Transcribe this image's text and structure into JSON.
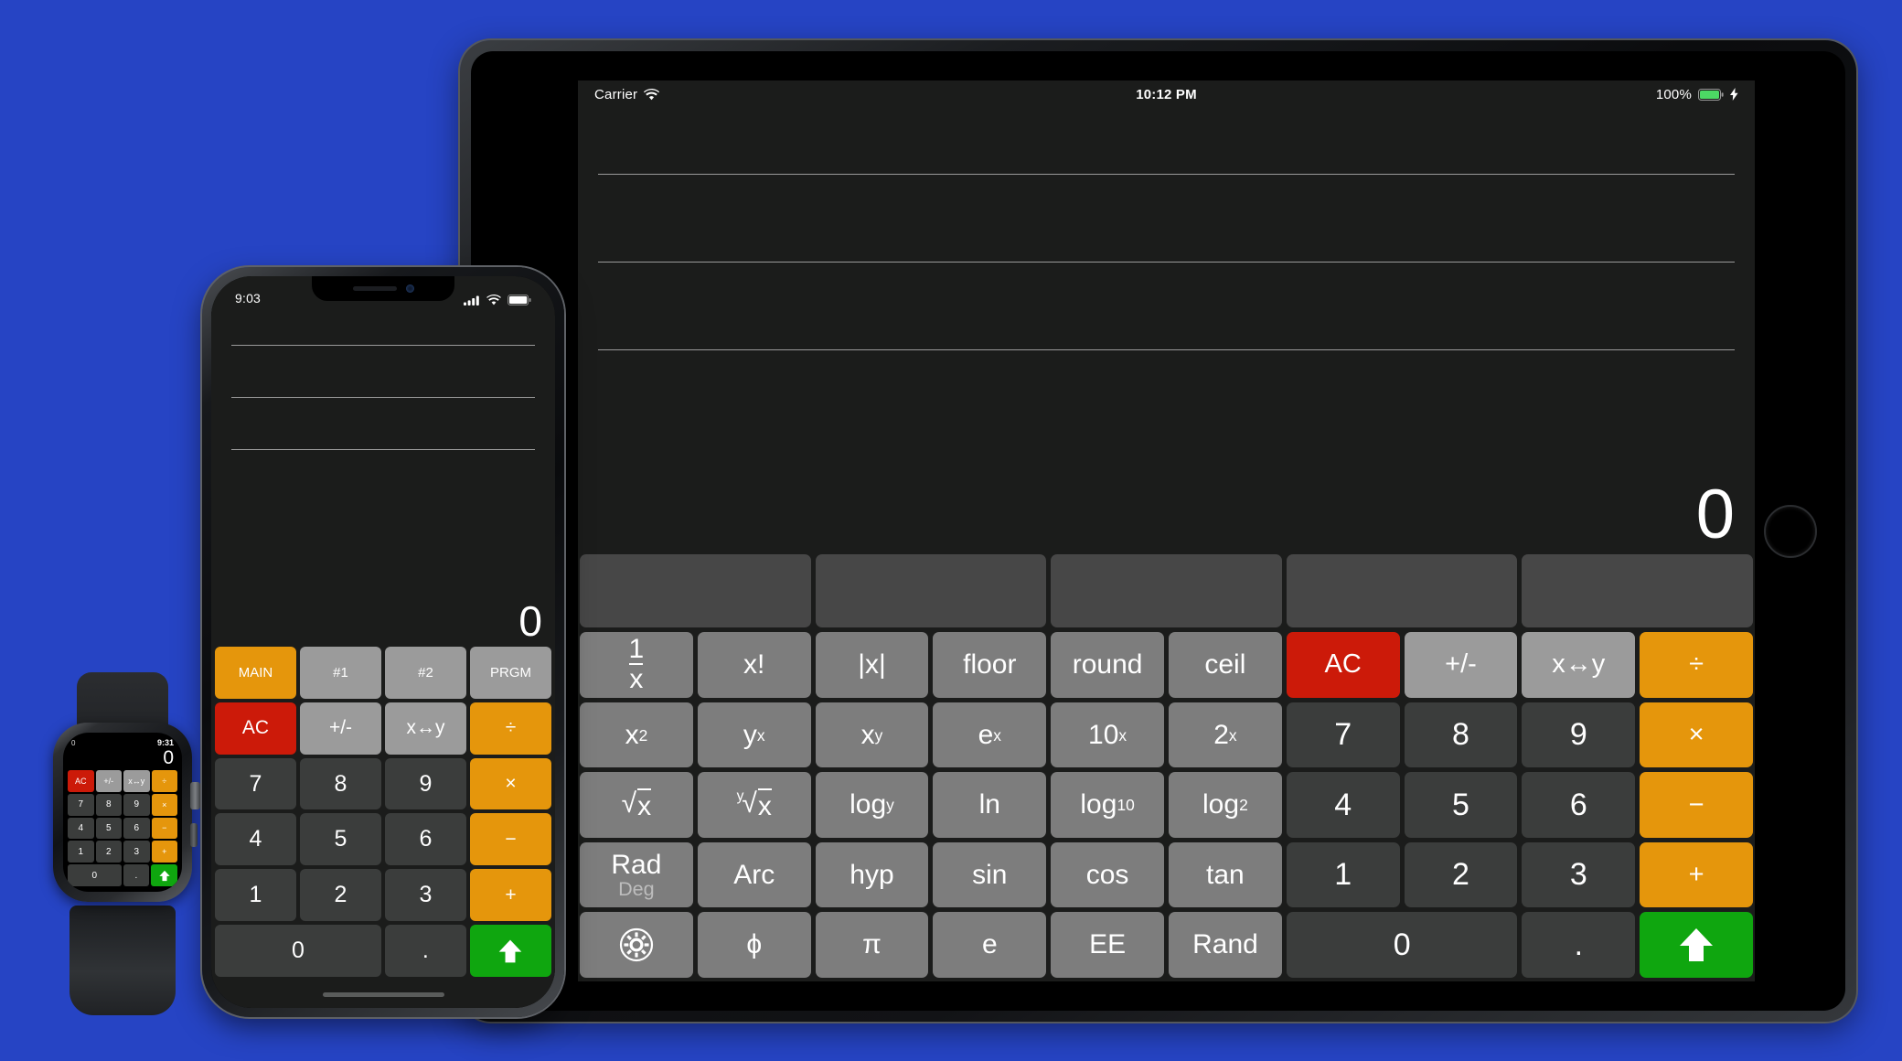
{
  "background_color": "#2644c4",
  "colors": {
    "ac_red": "#cc1a09",
    "operator_orange": "#e5960c",
    "enter_green": "#0fa60f",
    "function_gray": "#7d7d7d",
    "light_gray": "#9b9b9b",
    "number_gray": "#3b3d3c",
    "tab_gray": "#474747",
    "screen_black": "#1b1c1b"
  },
  "ipad": {
    "status_bar": {
      "carrier": "Carrier",
      "wifi_icon": "wifi-icon",
      "time": "10:12 PM",
      "battery_percent": "100%",
      "battery_icon": "battery-full-icon",
      "charging_icon": "lightning-bolt-icon"
    },
    "display": {
      "value": "0",
      "rule_count": 3
    },
    "tabs": [
      "",
      "",
      "",
      "",
      ""
    ],
    "keys": {
      "row1": [
        {
          "label": "1/x",
          "kind": "fraction",
          "num": "1",
          "den": "x",
          "style": "fn"
        },
        {
          "label": "x!",
          "style": "fn"
        },
        {
          "label": "|x|",
          "style": "fn"
        },
        {
          "label": "floor",
          "style": "fn"
        },
        {
          "label": "round",
          "style": "fn"
        },
        {
          "label": "ceil",
          "style": "fn"
        },
        {
          "label": "AC",
          "style": "ac"
        },
        {
          "label": "+/-",
          "style": "light"
        },
        {
          "label": "x↔y",
          "style": "light"
        },
        {
          "label": "÷",
          "style": "op"
        }
      ],
      "row2": [
        {
          "label": "x2",
          "base": "x",
          "sup": "2",
          "style": "fn"
        },
        {
          "label": "yx",
          "base": "y",
          "sup": "x",
          "style": "fn"
        },
        {
          "label": "xy",
          "base": "x",
          "sup": "y",
          "style": "fn"
        },
        {
          "label": "ex",
          "base": "e",
          "sup": "x",
          "style": "fn"
        },
        {
          "label": "10x",
          "base": "10",
          "sup": "x",
          "style": "fn"
        },
        {
          "label": "2x",
          "base": "2",
          "sup": "x",
          "style": "fn"
        },
        {
          "label": "7",
          "style": "num"
        },
        {
          "label": "8",
          "style": "num"
        },
        {
          "label": "9",
          "style": "num"
        },
        {
          "label": "×",
          "style": "op"
        }
      ],
      "row3": [
        {
          "label": "√x",
          "kind": "radical",
          "index": "",
          "style": "fn"
        },
        {
          "label": "y√x",
          "kind": "radical",
          "index": "y",
          "style": "fn"
        },
        {
          "label": "logy",
          "base": "log",
          "sub": "y",
          "style": "fn"
        },
        {
          "label": "ln",
          "style": "fn"
        },
        {
          "label": "log10",
          "base": "log",
          "sub": "10",
          "style": "fn"
        },
        {
          "label": "log2",
          "base": "log",
          "sub": "2",
          "style": "fn"
        },
        {
          "label": "4",
          "style": "num"
        },
        {
          "label": "5",
          "style": "num"
        },
        {
          "label": "6",
          "style": "num"
        },
        {
          "label": "−",
          "style": "op"
        }
      ],
      "row4": [
        {
          "label": "Rad",
          "second": "Deg",
          "kind": "twoline",
          "style": "fn"
        },
        {
          "label": "Arc",
          "style": "fn"
        },
        {
          "label": "hyp",
          "style": "fn"
        },
        {
          "label": "sin",
          "style": "fn"
        },
        {
          "label": "cos",
          "style": "fn"
        },
        {
          "label": "tan",
          "style": "fn"
        },
        {
          "label": "1",
          "style": "num"
        },
        {
          "label": "2",
          "style": "num"
        },
        {
          "label": "3",
          "style": "num"
        },
        {
          "label": "+",
          "style": "op"
        }
      ],
      "row5": [
        {
          "label": "settings",
          "kind": "gear-icon",
          "style": "fn"
        },
        {
          "label": "ϕ",
          "style": "fn"
        },
        {
          "label": "π",
          "style": "fn"
        },
        {
          "label": "e",
          "style": "fn"
        },
        {
          "label": "EE",
          "style": "fn"
        },
        {
          "label": "Rand",
          "style": "fn"
        },
        {
          "label": "0",
          "style": "num",
          "wide": true
        },
        {
          "label": ".",
          "style": "num"
        },
        {
          "label": "enter",
          "kind": "up-arrow-icon",
          "style": "enter"
        }
      ]
    }
  },
  "iphone": {
    "status_bar": {
      "time": "9:03",
      "signal_icon": "cellular-bars-icon",
      "wifi_icon": "wifi-icon",
      "battery_icon": "battery-full-icon"
    },
    "display": {
      "value": "0",
      "rule_count": 3
    },
    "tabs": [
      {
        "label": "MAIN",
        "active": true
      },
      {
        "label": "#1",
        "active": false
      },
      {
        "label": "#2",
        "active": false
      },
      {
        "label": "PRGM",
        "active": false
      }
    ],
    "keys": {
      "row1": [
        {
          "label": "AC",
          "style": "ac"
        },
        {
          "label": "+/-",
          "style": "light"
        },
        {
          "label": "x↔y",
          "style": "light"
        },
        {
          "label": "÷",
          "style": "op"
        }
      ],
      "row2": [
        {
          "label": "7",
          "style": "num"
        },
        {
          "label": "8",
          "style": "num"
        },
        {
          "label": "9",
          "style": "num"
        },
        {
          "label": "×",
          "style": "op"
        }
      ],
      "row3": [
        {
          "label": "4",
          "style": "num"
        },
        {
          "label": "5",
          "style": "num"
        },
        {
          "label": "6",
          "style": "num"
        },
        {
          "label": "−",
          "style": "op"
        }
      ],
      "row4": [
        {
          "label": "1",
          "style": "num"
        },
        {
          "label": "2",
          "style": "num"
        },
        {
          "label": "3",
          "style": "num"
        },
        {
          "label": "+",
          "style": "op"
        }
      ],
      "row5": [
        {
          "label": "0",
          "style": "num",
          "wide": true
        },
        {
          "label": ".",
          "style": "num"
        },
        {
          "label": "enter",
          "kind": "up-arrow-icon",
          "style": "enter"
        }
      ]
    }
  },
  "watch": {
    "status": {
      "left_value": "0",
      "time": "9:31"
    },
    "display": {
      "value": "0"
    },
    "keys": {
      "row1": [
        {
          "label": "AC",
          "style": "ac"
        },
        {
          "label": "+/-",
          "style": "light"
        },
        {
          "label": "x↔y",
          "style": "light"
        },
        {
          "label": "÷",
          "style": "op"
        }
      ],
      "row2": [
        {
          "label": "7",
          "style": "num"
        },
        {
          "label": "8",
          "style": "num"
        },
        {
          "label": "9",
          "style": "num"
        },
        {
          "label": "×",
          "style": "op"
        }
      ],
      "row3": [
        {
          "label": "4",
          "style": "num"
        },
        {
          "label": "5",
          "style": "num"
        },
        {
          "label": "6",
          "style": "num"
        },
        {
          "label": "−",
          "style": "op"
        }
      ],
      "row4": [
        {
          "label": "1",
          "style": "num"
        },
        {
          "label": "2",
          "style": "num"
        },
        {
          "label": "3",
          "style": "num"
        },
        {
          "label": "+",
          "style": "op"
        }
      ],
      "row5": [
        {
          "label": "0",
          "style": "num",
          "wide": true
        },
        {
          "label": ".",
          "style": "num"
        },
        {
          "label": "enter",
          "kind": "up-arrow-icon",
          "style": "enter"
        }
      ]
    }
  }
}
